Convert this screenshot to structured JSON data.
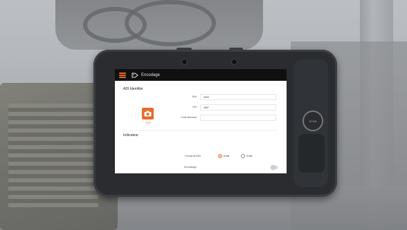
{
  "app": {
    "title": "Encodage",
    "menu_icon": "hamburger-menu-icon",
    "title_icon": "tag-icon",
    "accent_color": "#e86b2a"
  },
  "identifier": {
    "section_title": "ADI Identifier",
    "camera_label": "OCR",
    "fields": [
      {
        "label": "N/Id",
        "value": "0000"
      },
      {
        "label": "S/N",
        "value": "4567"
      },
      {
        "label": "Code fabricant",
        "value": ""
      }
    ]
  },
  "indicator": {
    "section_title": "Indicateur",
    "format_label": "Format ADDID",
    "options": [
      {
        "label": "8 bits",
        "selected": true
      },
      {
        "label": "9 bits",
        "selected": false
      }
    ],
    "toggle_label": "Horodatage",
    "toggle_on": false
  },
  "device": {
    "round_button_label": "SCAN"
  }
}
